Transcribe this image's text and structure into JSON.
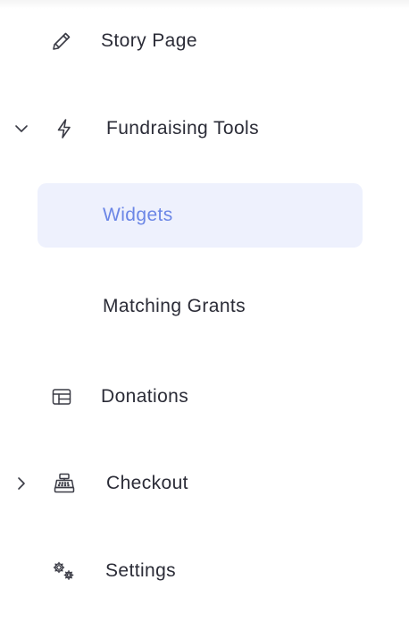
{
  "nav": {
    "story_page": {
      "label": "Story Page",
      "icon": "pencil-icon"
    },
    "fundraising_tools": {
      "label": "Fundraising Tools",
      "icon": "lightning-icon",
      "expanded": true,
      "children": {
        "widgets": {
          "label": "Widgets",
          "active": true
        },
        "matching_grants": {
          "label": "Matching Grants",
          "active": false
        }
      }
    },
    "donations": {
      "label": "Donations",
      "icon": "table-icon"
    },
    "checkout": {
      "label": "Checkout",
      "icon": "cash-register-icon",
      "expanded": false
    },
    "settings": {
      "label": "Settings",
      "icon": "gears-icon"
    }
  },
  "colors": {
    "active_bg": "#eef1fd",
    "active_text": "#6b86e6",
    "text": "#2b2c37",
    "icon": "#3a3b45"
  }
}
